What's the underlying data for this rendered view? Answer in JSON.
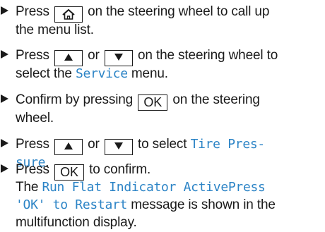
{
  "steps": [
    {
      "lines": [
        {
          "before": "Press",
          "key": "home-icon",
          "after": "on the steering wheel to call up"
        },
        {
          "text": "the menu list."
        }
      ]
    },
    {
      "lines": [
        {
          "before": "Press",
          "key1": "up-arrow-icon",
          "mid": "or",
          "key2": "down-arrow-icon",
          "after": "on the steering wheel to"
        },
        {
          "before": "select the",
          "highlight": "Service",
          "after": "menu."
        }
      ]
    },
    {
      "lines": [
        {
          "before": "Confirm by pressing",
          "key": "OK",
          "after": "on the steering"
        },
        {
          "text": "wheel."
        }
      ]
    },
    {
      "lines": [
        {
          "before": "Press",
          "key1": "up-arrow-icon",
          "mid": "or",
          "key2": "down-arrow-icon",
          "after": "to select",
          "highlight": "Tire Pres-"
        },
        {
          "highlight": "sure",
          "after": "."
        }
      ]
    },
    {
      "lines": [
        {
          "before": "Press",
          "key": "OK",
          "after": "to confirm."
        },
        {
          "before": "The",
          "highlight": "Run Flat Indicator Active",
          "highlight2": "Press"
        },
        {
          "highlight": "'OK' to Restart",
          "after": "message is shown in the"
        },
        {
          "text": "multifunction display."
        }
      ]
    }
  ],
  "colors": {
    "text": "#1a1a1a",
    "highlight": "#2c84c6"
  }
}
